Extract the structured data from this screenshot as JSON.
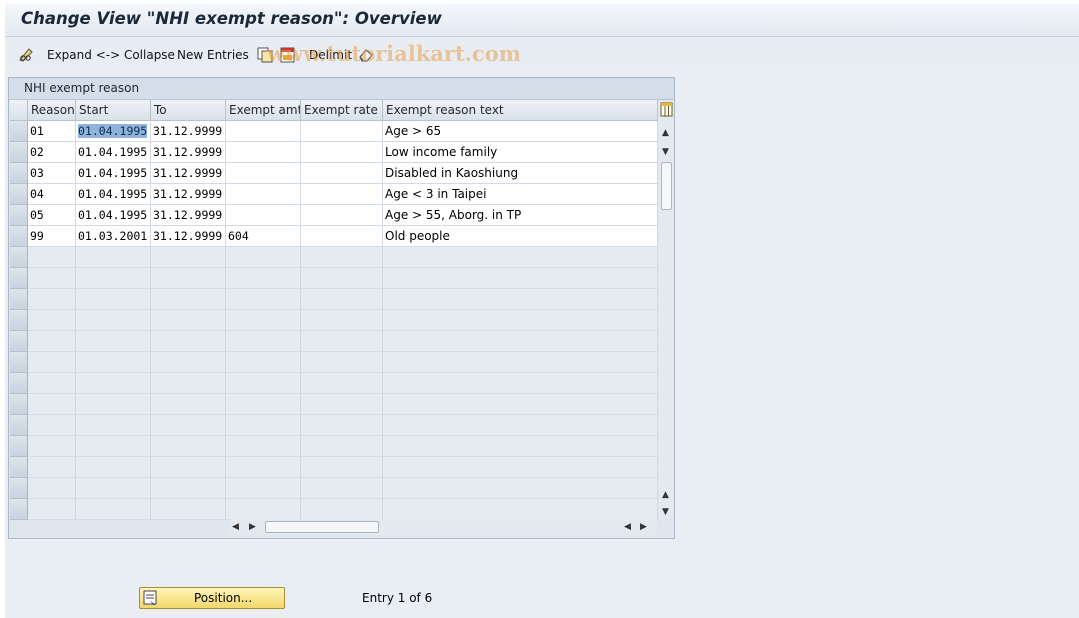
{
  "window": {
    "title": "Change View \"NHI exempt reason\": Overview"
  },
  "toolbar": {
    "expand_collapse_label": "Expand <-> Collapse",
    "new_entries_label": "New Entries",
    "delimit_label": "Delimit",
    "watermark": "www.tutorialkart.com"
  },
  "table": {
    "title": "NHI exempt reason",
    "columns": [
      "Reason",
      "Start",
      "To",
      "Exempt amt",
      "Exempt rate",
      "Exempt reason text"
    ],
    "rows": [
      {
        "reason": "01",
        "start": "01.04.1995",
        "to": "31.12.9999",
        "amt": "",
        "rate": "",
        "text": "Age > 65"
      },
      {
        "reason": "02",
        "start": "01.04.1995",
        "to": "31.12.9999",
        "amt": "",
        "rate": "",
        "text": "Low income family"
      },
      {
        "reason": "03",
        "start": "01.04.1995",
        "to": "31.12.9999",
        "amt": "",
        "rate": "",
        "text": "Disabled in Kaoshiung"
      },
      {
        "reason": "04",
        "start": "01.04.1995",
        "to": "31.12.9999",
        "amt": "",
        "rate": "",
        "text": "Age < 3 in Taipei"
      },
      {
        "reason": "05",
        "start": "01.04.1995",
        "to": "31.12.9999",
        "amt": "",
        "rate": "",
        "text": "Age > 55, Aborg. in TP"
      },
      {
        "reason": "99",
        "start": "01.03.2001",
        "to": "31.12.9999",
        "amt": "604",
        "rate": "",
        "text": "Old people"
      }
    ],
    "empty_row_count": 13
  },
  "footer": {
    "position_button_label": "Position...",
    "entry_info": "Entry 1 of 6"
  },
  "icons": {
    "toolbar": [
      "pencil-glasses-icon",
      "copy-icon",
      "save-table-icon",
      "eraser-icon"
    ],
    "table": [
      "column-config-icon"
    ],
    "footer": [
      "position-icon"
    ]
  },
  "colors": {
    "selection": "#8fb3dd",
    "button_yellow": "#f2d76a",
    "background": "#e9eef4"
  }
}
